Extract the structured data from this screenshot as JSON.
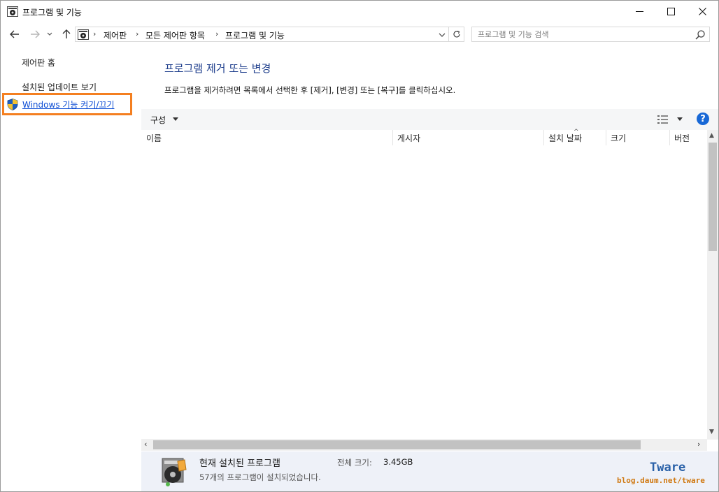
{
  "window": {
    "title": "프로그램 및 기능"
  },
  "address": {
    "breadcrumbs": [
      "제어판",
      "모든 제어판 항목",
      "프로그램 및 기능"
    ],
    "search_placeholder": "프로그램 및 기능 검색"
  },
  "sidebar": {
    "items": [
      {
        "label": "제어판 홈"
      },
      {
        "label": "설치된 업데이트 보기"
      },
      {
        "label": "Windows 기능 켜기/끄기",
        "highlighted": true,
        "highlight_color": "#f47f20"
      }
    ]
  },
  "main": {
    "title": "프로그램 제거 또는 변경",
    "description": "프로그램을 제거하려면 목록에서 선택한 후 [제거], [변경] 또는 [복구]를 클릭하십시오."
  },
  "toolbar": {
    "organize_label": "구성",
    "help_icon": "help-icon"
  },
  "columns": [
    "이름",
    "게시자",
    "설치 날짜",
    "크기",
    "버전"
  ],
  "details": {
    "title": "현재 설치된 프로그램",
    "count": "57개의 프로그램이 설치되었습니다.",
    "size_label": "전체 크기:",
    "size_value": "3.45GB"
  },
  "watermark": {
    "name": "Tware",
    "url": "blog.daum.net/tware"
  },
  "colors": {
    "title_blue": "#1e3e8c",
    "link_blue": "#0a4bd4",
    "highlight_orange": "#f47f20",
    "details_bg": "#eef1f8"
  }
}
